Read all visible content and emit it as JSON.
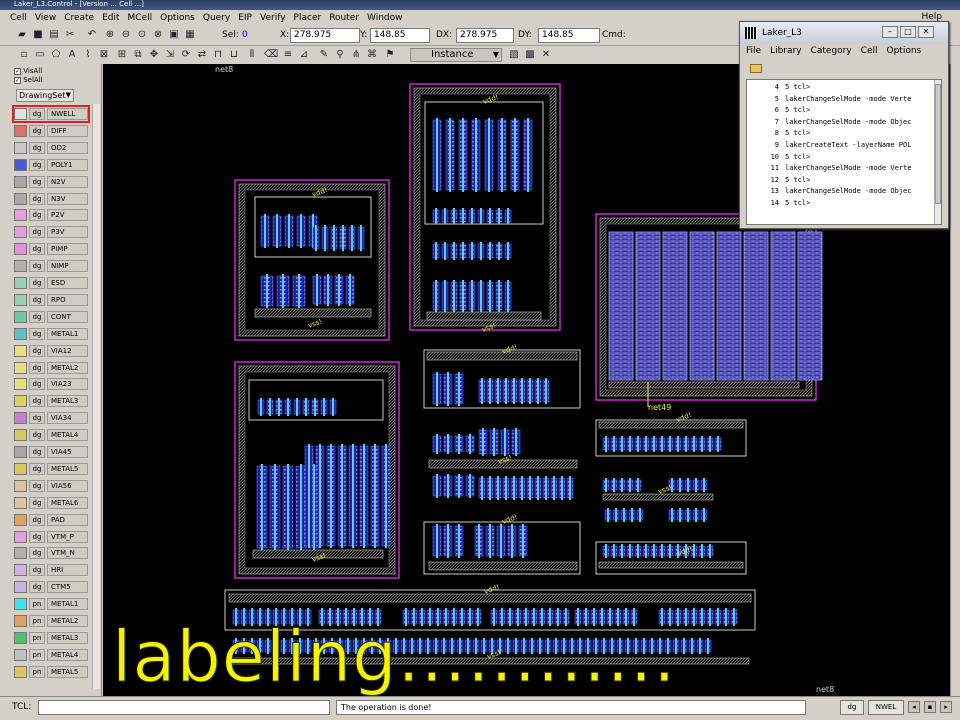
{
  "window_title": "Laker_L3.Control - [Version ... Cell ...]",
  "menubar": [
    "Cell",
    "View",
    "Create",
    "Edit",
    "MCell",
    "Options",
    "Query",
    "EIP",
    "Verify",
    "Placer",
    "Router",
    "Window"
  ],
  "help_label": "Help",
  "toolbar": {
    "sel_label": "Sel:",
    "sel_value": "0",
    "x_label": "X:",
    "x_value": "278.975",
    "y_label": "Y:",
    "y_value": "148.85",
    "dx_label": "DX:",
    "dx_value": "278.975",
    "dy_label": "DY:",
    "dy_value": "148.85",
    "cmd_label": "Cmd:",
    "mode": "Instance"
  },
  "left_panel": {
    "vis_all": "VisAll",
    "sel_all": "SelAll",
    "drawing_set": "DrawingSet",
    "layers": [
      {
        "purpose": "dg",
        "name": "NWELL",
        "color": "#e0e0e0",
        "selected": true
      },
      {
        "purpose": "dg",
        "name": "DIFF",
        "color": "#e07070"
      },
      {
        "purpose": "dg",
        "name": "OD2",
        "color": "#c8c8c8"
      },
      {
        "purpose": "dg",
        "name": "POLY1",
        "color": "#4a5ad0"
      },
      {
        "purpose": "dg",
        "name": "N2V",
        "color": "#a8a8a8"
      },
      {
        "purpose": "dg",
        "name": "N3V",
        "color": "#a8a8a8"
      },
      {
        "purpose": "dg",
        "name": "P2V",
        "color": "#e0a0e0"
      },
      {
        "purpose": "dg",
        "name": "P3V",
        "color": "#e0a0e0"
      },
      {
        "purpose": "dg",
        "name": "PIMP",
        "color": "#e090e0"
      },
      {
        "purpose": "dg",
        "name": "NIMP",
        "color": "#b0b0b0"
      },
      {
        "purpose": "dg",
        "name": "ESD",
        "color": "#9ad0b0"
      },
      {
        "purpose": "dg",
        "name": "RPO",
        "color": "#9ad0b0"
      },
      {
        "purpose": "dg",
        "name": "CONT",
        "color": "#70c8a0"
      },
      {
        "purpose": "dg",
        "name": "METAL1",
        "color": "#60c0c8"
      },
      {
        "purpose": "dg",
        "name": "VIA12",
        "color": "#e8e080"
      },
      {
        "purpose": "dg",
        "name": "METAL2",
        "color": "#e8e080"
      },
      {
        "purpose": "dg",
        "name": "VIA23",
        "color": "#e8e080"
      },
      {
        "purpose": "dg",
        "name": "METAL3",
        "color": "#d8d060"
      },
      {
        "purpose": "dg",
        "name": "VIA34",
        "color": "#c080d0"
      },
      {
        "purpose": "dg",
        "name": "METAL4",
        "color": "#d8c860"
      },
      {
        "purpose": "dg",
        "name": "VIA45",
        "color": "#a8a8a8"
      },
      {
        "purpose": "dg",
        "name": "METAL5",
        "color": "#d8c860"
      },
      {
        "purpose": "dg",
        "name": "VIA56",
        "color": "#e0c0a0"
      },
      {
        "purpose": "dg",
        "name": "METAL6",
        "color": "#e0c0a0"
      },
      {
        "purpose": "dg",
        "name": "PAD",
        "color": "#e0a060"
      },
      {
        "purpose": "dg",
        "name": "VTM_P",
        "color": "#e0a0e0"
      },
      {
        "purpose": "dg",
        "name": "VTM_N",
        "color": "#b0b0b0"
      },
      {
        "purpose": "dg",
        "name": "HRI",
        "color": "#d0b0e0"
      },
      {
        "purpose": "dg",
        "name": "CTM5",
        "color": "#d0b0e0"
      },
      {
        "purpose": "pn",
        "name": "METAL1",
        "color": "#40e0f0"
      },
      {
        "purpose": "pn",
        "name": "METAL2",
        "color": "#e0a060"
      },
      {
        "purpose": "pn",
        "name": "METAL3",
        "color": "#50c070"
      },
      {
        "purpose": "pn",
        "name": "METAL4",
        "color": "#c0c0c0"
      },
      {
        "purpose": "pn",
        "name": "METAL5",
        "color": "#d8c860"
      }
    ]
  },
  "canvas": {
    "net_labels": [
      "net8",
      "net49",
      "net8"
    ],
    "power_labels": [
      "vdd!",
      "vss!"
    ]
  },
  "laker_window": {
    "title": "Laker_L3",
    "menu": [
      "File",
      "Library",
      "Category",
      "Cell",
      "Options"
    ],
    "console": [
      {
        "num": "4",
        "text": "5 tcl>"
      },
      {
        "num": "5",
        "text": "lakerChangeSelMode -mode Verte"
      },
      {
        "num": "6",
        "text": "5 tcl>"
      },
      {
        "num": "7",
        "text": "lakerChangeSelMode -mode Objec"
      },
      {
        "num": "8",
        "text": "5 tcl>"
      },
      {
        "num": "9",
        "text": "lakerCreateText -layerName POL"
      },
      {
        "num": "10",
        "text": "5 tcl>"
      },
      {
        "num": "11",
        "text": "lakerChangeSelMode -mode Verte"
      },
      {
        "num": "12",
        "text": "5 tcl>"
      },
      {
        "num": "13",
        "text": "lakerChangeSelMode -mode Objec"
      },
      {
        "num": "14",
        "text": "5 tcl>"
      }
    ]
  },
  "status": {
    "tcl_label": "TCL:",
    "message": "The operation is done!",
    "purpose": "dg",
    "layer": "NWEL"
  },
  "caption": "labeling............"
}
